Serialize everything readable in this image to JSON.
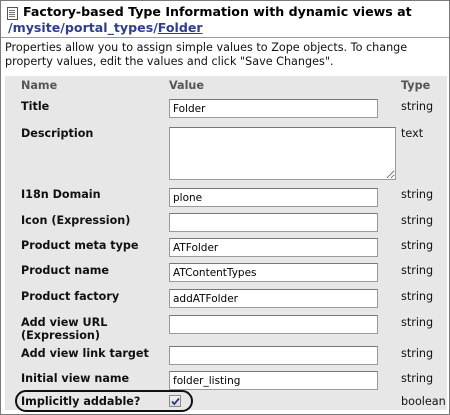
{
  "header": {
    "title": "Factory-based Type Information with dynamic views at",
    "path_prefix": "/mysite/portal_types/",
    "path_link": "Folder"
  },
  "intro": "Properties allow you to assign simple values to Zope objects. To change property values, edit the values and click \"Save Changes\".",
  "columns": {
    "name": "Name",
    "value": "Value",
    "type": "Type"
  },
  "properties": [
    {
      "label": "Title",
      "value": "Folder",
      "type": "string"
    },
    {
      "label": "Description",
      "value": "",
      "type": "text"
    },
    {
      "label": "I18n Domain",
      "value": "plone",
      "type": "string"
    },
    {
      "label": "Icon (Expression)",
      "value": "",
      "type": "string"
    },
    {
      "label": "Product meta type",
      "value": "ATFolder",
      "type": "string"
    },
    {
      "label": "Product name",
      "value": "ATContentTypes",
      "type": "string"
    },
    {
      "label": "Product factory",
      "value": "addATFolder",
      "type": "string"
    },
    {
      "label": "Add view URL (Expression)",
      "value": "",
      "type": "string"
    },
    {
      "label": "Add view link target",
      "value": "",
      "type": "string"
    },
    {
      "label": "Initial view name",
      "value": "folder_listing",
      "type": "string"
    },
    {
      "label": "Implicitly addable?",
      "value": true,
      "type": "boolean"
    }
  ],
  "icons": {
    "header": "document-icon",
    "checkbox": "checkmark-icon"
  },
  "colors": {
    "link": "#2d3e8f",
    "panel": "#e7e7e7"
  }
}
